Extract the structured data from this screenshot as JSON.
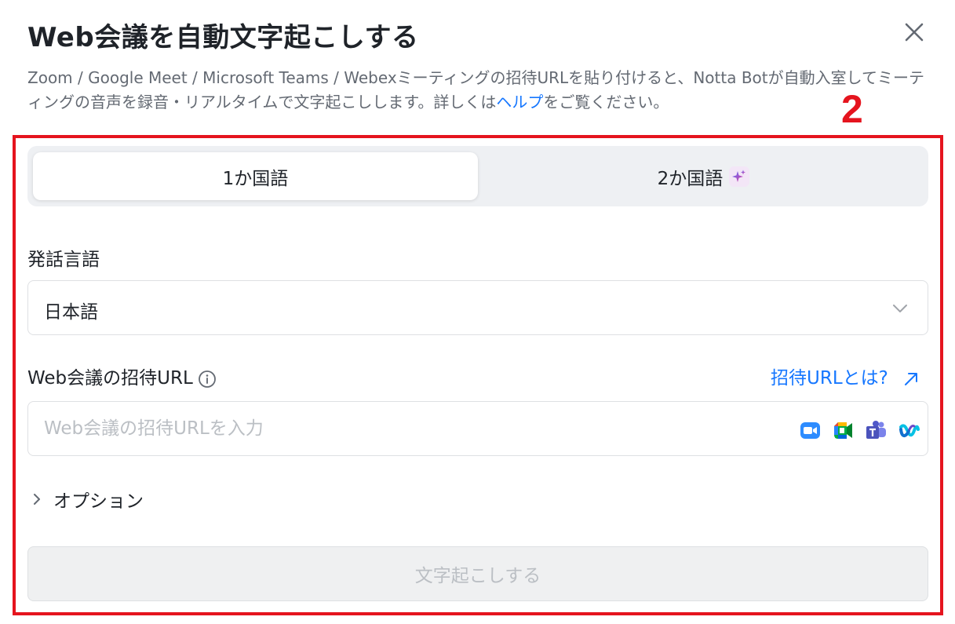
{
  "dialog": {
    "title": "Web会議を自動文字起こしする",
    "description_text": "Zoom / Google Meet / Microsoft Teams / Webexミーティングの招待URLを貼り付けると、Notta Botが自動入室してミーティングの音声を録音・リアルタイムで文字起こしします。詳しくは",
    "description_link": "ヘルプ",
    "description_tail": "をご覧ください。"
  },
  "annotation": {
    "number": "2",
    "color": "#e5141e"
  },
  "tabs": [
    {
      "label": "1か国語",
      "active": true
    },
    {
      "label": "2か国語",
      "active": false,
      "badge_icon": "sparkle-icon"
    }
  ],
  "language": {
    "label": "発話言語",
    "selected": "日本語"
  },
  "invite": {
    "label": "Web会議の招待URL",
    "help_link": "招待URLとは?",
    "placeholder": "Web会議の招待URLを入力",
    "platform_icons": [
      "zoom-icon",
      "google-meet-icon",
      "teams-icon",
      "webex-icon"
    ]
  },
  "options": {
    "label": "オプション"
  },
  "submit": {
    "label": "文字起こしする",
    "disabled": true
  },
  "colors": {
    "accent": "#1677ff",
    "annotation": "#e5141e"
  }
}
